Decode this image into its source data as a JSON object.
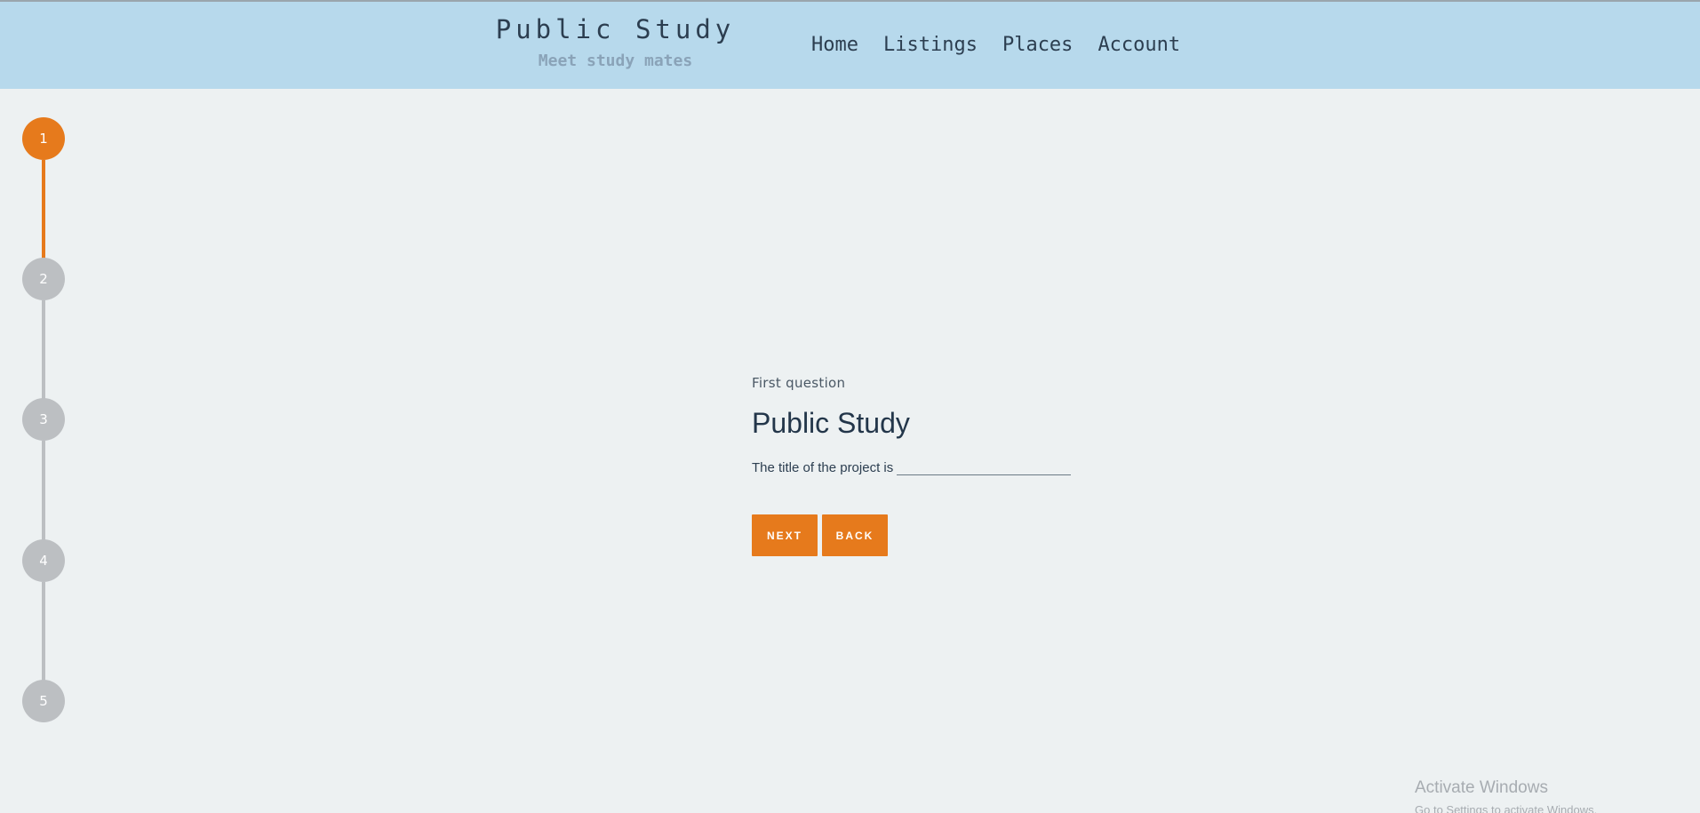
{
  "header": {
    "brand_title": "Public Study",
    "brand_subtitle": "Meet study mates",
    "nav": [
      "Home",
      "Listings",
      "Places",
      "Account"
    ]
  },
  "stepper": {
    "steps": [
      "1",
      "2",
      "3",
      "4",
      "5"
    ],
    "active_step": 1,
    "active_color": "#e67a1c",
    "inactive_color": "#bcbfc2"
  },
  "question": {
    "eyebrow": "First question",
    "heading": "Public Study",
    "prompt": "The title of the project is",
    "input_value": ""
  },
  "buttons": {
    "next": "NEXT",
    "back": "BACK"
  },
  "watermark": {
    "line1": "Activate Windows",
    "line2": "Go to Settings to activate Windows."
  }
}
